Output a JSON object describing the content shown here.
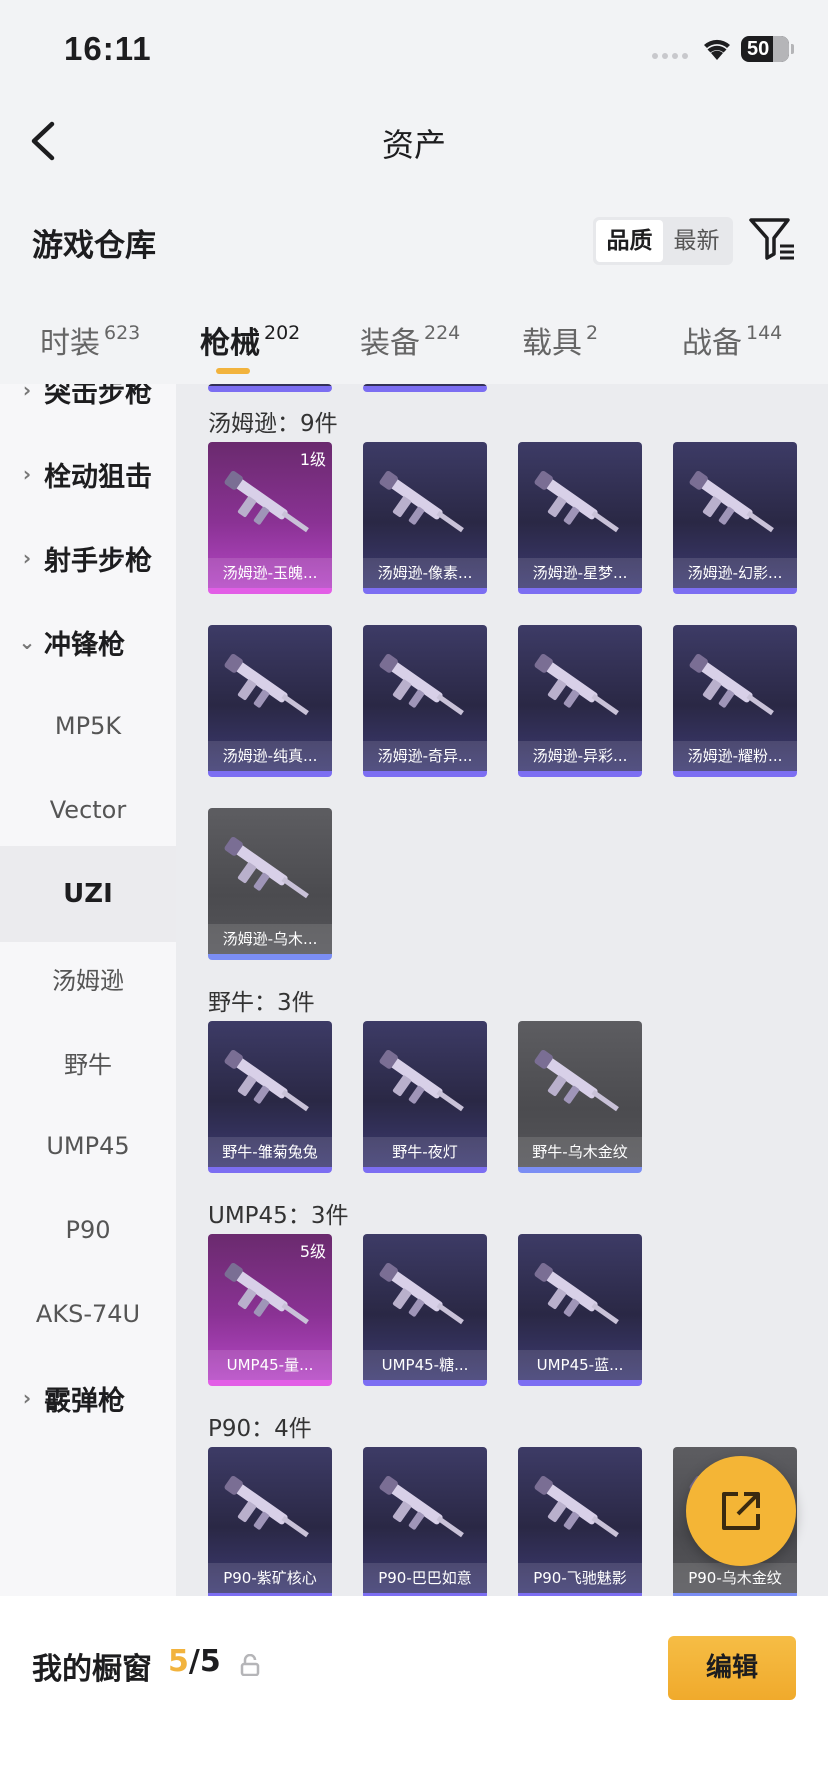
{
  "status_bar": {
    "time": "16:11",
    "battery": "50"
  },
  "nav": {
    "title": "资产"
  },
  "warehouse": {
    "title": "游戏仓库",
    "sort_options": [
      "品质",
      "最新"
    ],
    "active_sort": "品质"
  },
  "tabs": [
    {
      "label": "时装",
      "count": "623"
    },
    {
      "label": "枪械",
      "count": "202",
      "active": true
    },
    {
      "label": "装备",
      "count": "224"
    },
    {
      "label": "载具",
      "count": "2"
    },
    {
      "label": "战备",
      "count": "144"
    }
  ],
  "sidebar": {
    "items": [
      {
        "label": "突击步枪",
        "type": "category",
        "expanded": false
      },
      {
        "label": "栓动狙击",
        "type": "category",
        "expanded": false
      },
      {
        "label": "射手步枪",
        "type": "category",
        "expanded": false
      },
      {
        "label": "冲锋枪",
        "type": "category",
        "expanded": true
      },
      {
        "label": "MP5K",
        "type": "sub"
      },
      {
        "label": "Vector",
        "type": "sub"
      },
      {
        "label": "UZI",
        "type": "sub",
        "active": true
      },
      {
        "label": "汤姆逊",
        "type": "sub"
      },
      {
        "label": "野牛",
        "type": "sub"
      },
      {
        "label": "UMP45",
        "type": "sub"
      },
      {
        "label": "P90",
        "type": "sub"
      },
      {
        "label": "AKS-74U",
        "type": "sub"
      },
      {
        "label": "霰弹枪",
        "type": "category",
        "expanded": false
      }
    ]
  },
  "sections": [
    {
      "title": "汤姆逊：9件",
      "items": [
        {
          "name": "汤姆逊-玉魄...",
          "rarity": "legend",
          "level": "1级"
        },
        {
          "name": "汤姆逊-像素...",
          "rarity": "epic"
        },
        {
          "name": "汤姆逊-星梦...",
          "rarity": "epic"
        },
        {
          "name": "汤姆逊-幻影...",
          "rarity": "epic"
        },
        {
          "name": "汤姆逊-纯真...",
          "rarity": "epic"
        },
        {
          "name": "汤姆逊-奇异...",
          "rarity": "epic"
        },
        {
          "name": "汤姆逊-异彩...",
          "rarity": "epic"
        },
        {
          "name": "汤姆逊-耀粉...",
          "rarity": "epic"
        },
        {
          "name": "汤姆逊-乌木...",
          "rarity": "gray"
        }
      ]
    },
    {
      "title": "野牛：3件",
      "items": [
        {
          "name": "野牛-雏菊兔兔",
          "rarity": "epic"
        },
        {
          "name": "野牛-夜灯",
          "rarity": "epic"
        },
        {
          "name": "野牛-乌木金纹",
          "rarity": "gray"
        }
      ]
    },
    {
      "title": "UMP45：3件",
      "items": [
        {
          "name": "UMP45-量...",
          "rarity": "legend",
          "level": "5级"
        },
        {
          "name": "UMP45-糖...",
          "rarity": "epic"
        },
        {
          "name": "UMP45-蓝...",
          "rarity": "epic"
        }
      ]
    },
    {
      "title": "P90：4件",
      "items": [
        {
          "name": "P90-紫矿核心",
          "rarity": "epic"
        },
        {
          "name": "P90-巴巴如意",
          "rarity": "epic"
        },
        {
          "name": "P90-飞驰魅影",
          "rarity": "epic"
        },
        {
          "name": "P90-乌木金纹",
          "rarity": "gray"
        }
      ]
    }
  ],
  "fab": {
    "icon": "share-icon"
  },
  "showcase": {
    "label": "我的橱窗",
    "current": "5",
    "total": "/5",
    "edit_label": "编辑"
  },
  "colors": {
    "accent": "#f2b33d",
    "epic": "#7c6ef2",
    "legend": "#e25ee6"
  }
}
